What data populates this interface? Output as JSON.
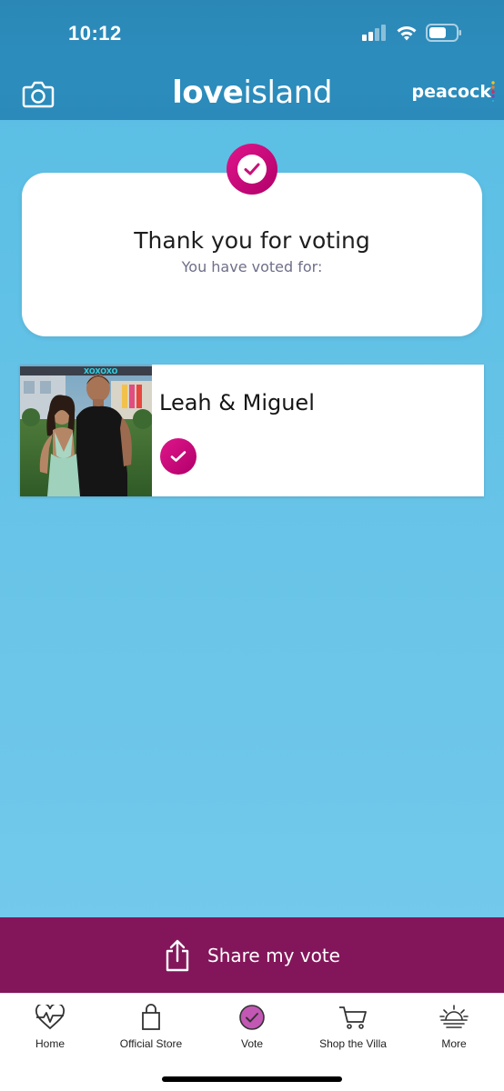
{
  "status_bar": {
    "time": "10:12"
  },
  "header": {
    "logo_love": "love",
    "logo_island": "island",
    "partner_logo": "peacock",
    "camera_icon": "camera-icon"
  },
  "confirmation": {
    "title": "Thank you for voting",
    "subtitle": "You have voted for:"
  },
  "vote": {
    "couple_name": "Leah & Miguel"
  },
  "share": {
    "label": "Share my vote",
    "icon": "share-icon"
  },
  "tabs": [
    {
      "label": "Home",
      "icon": "heartbeat-icon"
    },
    {
      "label": "Official Store",
      "icon": "shopping-bag-icon"
    },
    {
      "label": "Vote",
      "icon": "vote-check-icon",
      "active": true
    },
    {
      "label": "Shop the Villa",
      "icon": "cart-icon"
    },
    {
      "label": "More",
      "icon": "sunset-icon"
    }
  ],
  "colors": {
    "header_blue": "#2b88b6",
    "background_blue": "#62c2e7",
    "accent_magenta": "#d0107e",
    "share_bar": "#83165a"
  }
}
